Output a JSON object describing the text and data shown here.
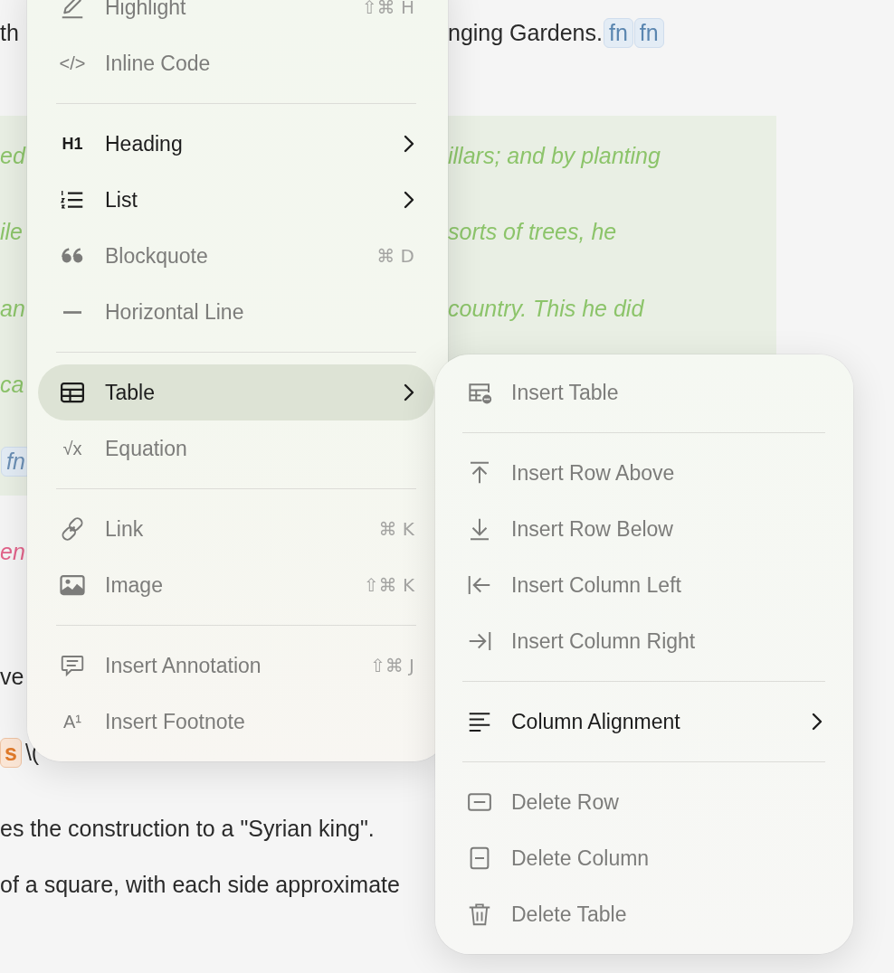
{
  "document": {
    "blocks": [
      {
        "kind": "para",
        "left": [
          {
            "kind": "text",
            "text": "th"
          }
        ],
        "right": [
          {
            "kind": "text",
            "text": "nging Gardens."
          },
          {
            "kind": "fn",
            "text": "fn"
          },
          {
            "kind": "fn",
            "text": "fn"
          }
        ]
      },
      {
        "kind": "quote",
        "lines": [
          {
            "left": [
              {
                "kind": "text",
                "text": "ed"
              }
            ],
            "right": [
              {
                "kind": "text",
                "text": "illars; and by planting"
              }
            ]
          },
          {
            "left": [
              {
                "kind": "text",
                "text": "ile"
              }
            ],
            "right": [
              {
                "kind": "text",
                "text": "sorts of trees, he"
              }
            ]
          },
          {
            "left": [
              {
                "kind": "text",
                "text": "an"
              }
            ],
            "right": [
              {
                "kind": "text",
                "text": "country. This he did"
              }
            ]
          },
          {
            "left": [
              {
                "kind": "text",
                "text": "ca"
              }
            ]
          },
          {
            "left": [
              {
                "kind": "fn",
                "text": "fn"
              }
            ]
          }
        ]
      },
      {
        "kind": "para",
        "left": [
          {
            "kind": "pink",
            "text": "en"
          }
        ]
      },
      {
        "kind": "para",
        "left": [
          {
            "kind": "text",
            "text": "ve"
          }
        ]
      },
      {
        "kind": "para",
        "left": [
          {
            "kind": "tag",
            "text": "s"
          },
          {
            "kind": "text",
            "text": "\\("
          }
        ]
      },
      {
        "kind": "para",
        "left": [
          {
            "kind": "text",
            "text": "es the construction to a \"Syrian king\"."
          }
        ]
      },
      {
        "kind": "para",
        "left": [
          {
            "kind": "text",
            "text": "of a square, with each side approximate"
          }
        ]
      }
    ]
  },
  "context_menu": {
    "sections": [
      {
        "items": [
          {
            "label": "Highlight",
            "shortcut": "⇧⌘ H",
            "submenu": false,
            "selected": false,
            "disabled": true
          },
          {
            "label": "Inline Code",
            "icon_text": "</>",
            "submenu": false,
            "selected": false,
            "disabled": true
          }
        ]
      },
      {
        "items": [
          {
            "label": "Heading",
            "icon_text": "H1",
            "submenu": true,
            "selected": false,
            "disabled": false
          },
          {
            "label": "List",
            "submenu": true,
            "selected": false,
            "disabled": false
          },
          {
            "label": "Blockquote",
            "shortcut": "⌘ D",
            "submenu": false,
            "selected": false,
            "disabled": true
          },
          {
            "label": "Horizontal Line",
            "submenu": false,
            "selected": false,
            "disabled": true
          }
        ]
      },
      {
        "items": [
          {
            "label": "Table",
            "submenu": true,
            "selected": true,
            "disabled": false
          },
          {
            "label": "Equation",
            "icon_text": "√x",
            "submenu": false,
            "selected": false,
            "disabled": true
          }
        ]
      },
      {
        "items": [
          {
            "label": "Link",
            "shortcut": "⌘ K",
            "submenu": false,
            "selected": false,
            "disabled": true
          },
          {
            "label": "Image",
            "shortcut": "⇧⌘ K",
            "submenu": false,
            "selected": false,
            "disabled": true
          }
        ]
      },
      {
        "items": [
          {
            "label": "Insert Annotation",
            "shortcut": "⇧⌘ J",
            "submenu": false,
            "selected": false,
            "disabled": true
          },
          {
            "label": "Insert Footnote",
            "icon_text": "A¹",
            "submenu": false,
            "selected": false,
            "disabled": true
          }
        ]
      }
    ]
  },
  "submenu": {
    "sections": [
      {
        "items": [
          {
            "label": "Insert Table",
            "submenu": false,
            "selected": false,
            "disabled": true
          }
        ]
      },
      {
        "items": [
          {
            "label": "Insert Row Above",
            "submenu": false,
            "selected": false,
            "disabled": true
          },
          {
            "label": "Insert Row Below",
            "submenu": false,
            "selected": false,
            "disabled": true
          },
          {
            "label": "Insert Column Left",
            "submenu": false,
            "selected": false,
            "disabled": true
          },
          {
            "label": "Insert Column Right",
            "submenu": false,
            "selected": false,
            "disabled": true
          }
        ]
      },
      {
        "items": [
          {
            "label": "Column Alignment",
            "submenu": true,
            "selected": false,
            "disabled": false
          }
        ]
      },
      {
        "items": [
          {
            "label": "Delete Row",
            "submenu": false,
            "selected": false,
            "disabled": true
          },
          {
            "label": "Delete Column",
            "submenu": false,
            "selected": false,
            "disabled": true
          },
          {
            "label": "Delete Table",
            "submenu": false,
            "selected": false,
            "disabled": true
          }
        ]
      }
    ]
  }
}
